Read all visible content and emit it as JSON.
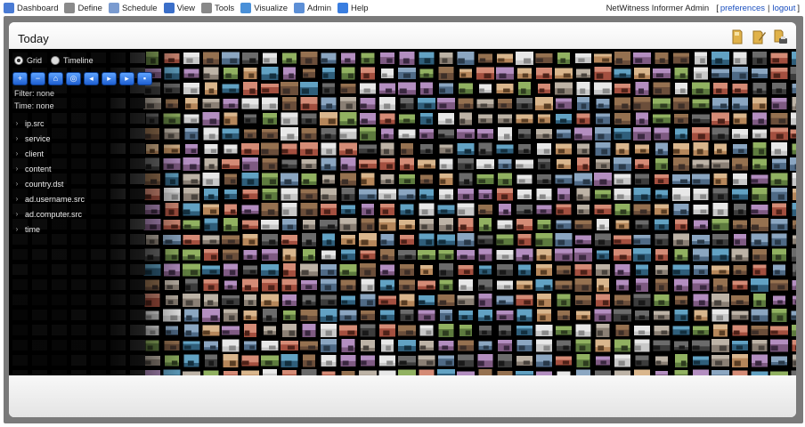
{
  "nav": {
    "items": [
      {
        "label": "Dashboard",
        "icon": "dashboard-icon",
        "color": "#4a7bd4"
      },
      {
        "label": "Define",
        "icon": "define-icon",
        "color": "#8a8a8a"
      },
      {
        "label": "Schedule",
        "icon": "schedule-icon",
        "color": "#7a9bd0"
      },
      {
        "label": "View",
        "icon": "view-icon",
        "color": "#3b6fc9"
      },
      {
        "label": "Tools",
        "icon": "tools-icon",
        "color": "#888888"
      },
      {
        "label": "Visualize",
        "icon": "visualize-icon",
        "color": "#4a90d8"
      },
      {
        "label": "Admin",
        "icon": "admin-icon",
        "color": "#5c8fd6"
      },
      {
        "label": "Help",
        "icon": "help-icon",
        "color": "#3a7ee0"
      }
    ],
    "user": "NetWitness Informer Admin",
    "preferences": "preferences",
    "logout": "logout",
    "bracket_open": "[",
    "pipe": "|",
    "bracket_close": "]"
  },
  "panel": {
    "title": "Today"
  },
  "controls": {
    "mode_grid": "Grid",
    "mode_timeline": "Timeline",
    "selected_mode": "Grid",
    "filter": "Filter: none",
    "time": "Time: none",
    "buttons": [
      "zoom-in-icon",
      "zoom-out-icon",
      "home-icon",
      "fit-icon",
      "first-icon",
      "play-icon",
      "last-icon",
      "lock-icon"
    ],
    "tree": [
      "ip.src",
      "service",
      "client",
      "content",
      "country.dst",
      "ad.username.src",
      "ad.computer.src",
      "time"
    ]
  }
}
